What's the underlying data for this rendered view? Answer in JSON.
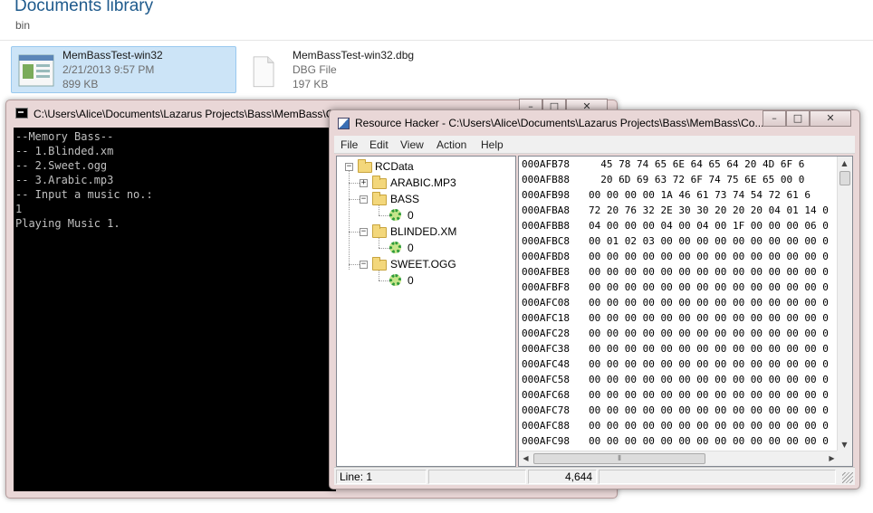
{
  "explorer": {
    "library_title": "Documents library",
    "library_subtitle": "bin",
    "files": [
      {
        "name": "MemBassTest-win32",
        "date": "2/21/2013 9:57 PM",
        "size": "899 KB",
        "icon": "application-icon",
        "selected": true
      },
      {
        "name": "MemBassTest-win32.dbg",
        "type": "DBG File",
        "size": "197 KB",
        "icon": "document-icon",
        "selected": false
      }
    ]
  },
  "console": {
    "title": "C:\\Users\\Alice\\Documents\\Lazarus Projects\\Bass\\MemBass\\Co",
    "caption_buttons": {
      "minimize": "–",
      "maximize": "□",
      "close": "✕"
    },
    "lines": [
      "--Memory Bass--",
      "-- 1.Blinded.xm",
      "-- 2.Sweet.ogg",
      "-- 3.Arabic.mp3",
      "-- Input a music no.:",
      "1",
      "Playing Music 1."
    ]
  },
  "resource_hacker": {
    "title": "Resource Hacker  -  C:\\Users\\Alice\\Documents\\Lazarus Projects\\Bass\\MemBass\\Co...",
    "caption_buttons": {
      "minimize": "–",
      "maximize": "□",
      "close": "✕"
    },
    "menu": [
      "File",
      "Edit",
      "View",
      "Action",
      "Help"
    ],
    "tree": {
      "root": "RCData",
      "children": [
        {
          "label": "ARABIC.MP3",
          "expanded": false,
          "items": []
        },
        {
          "label": "BASS",
          "expanded": true,
          "items": [
            "0"
          ]
        },
        {
          "label": "BLINDED.XM",
          "expanded": true,
          "items": [
            "0"
          ]
        },
        {
          "label": "SWEET.OGG",
          "expanded": true,
          "items": [
            "0"
          ]
        }
      ]
    },
    "hex_rows": [
      {
        "addr": "000AFB78",
        "bytes": "  45 78 74 65 6E 64 65 64 20 4D 6F 6"
      },
      {
        "addr": "000AFB88",
        "bytes": "  20 6D 69 63 72 6F 74 75 6E 65 00 0"
      },
      {
        "addr": "000AFB98",
        "bytes": "00 00 00 00 1A 46 61 73 74 54 72 61 6"
      },
      {
        "addr": "000AFBA8",
        "bytes": "72 20 76 32 2E 30 30 20 20 20 04 01 14 0"
      },
      {
        "addr": "000AFBB8",
        "bytes": "04 00 00 00 04 00 04 00 1F 00 00 00 06 0"
      },
      {
        "addr": "000AFBC8",
        "bytes": "00 01 02 03 00 00 00 00 00 00 00 00 00 0"
      },
      {
        "addr": "000AFBD8",
        "bytes": "00 00 00 00 00 00 00 00 00 00 00 00 00 0"
      },
      {
        "addr": "000AFBE8",
        "bytes": "00 00 00 00 00 00 00 00 00 00 00 00 00 0"
      },
      {
        "addr": "000AFBF8",
        "bytes": "00 00 00 00 00 00 00 00 00 00 00 00 00 0"
      },
      {
        "addr": "000AFC08",
        "bytes": "00 00 00 00 00 00 00 00 00 00 00 00 00 0"
      },
      {
        "addr": "000AFC18",
        "bytes": "00 00 00 00 00 00 00 00 00 00 00 00 00 0"
      },
      {
        "addr": "000AFC28",
        "bytes": "00 00 00 00 00 00 00 00 00 00 00 00 00 0"
      },
      {
        "addr": "000AFC38",
        "bytes": "00 00 00 00 00 00 00 00 00 00 00 00 00 0"
      },
      {
        "addr": "000AFC48",
        "bytes": "00 00 00 00 00 00 00 00 00 00 00 00 00 0"
      },
      {
        "addr": "000AFC58",
        "bytes": "00 00 00 00 00 00 00 00 00 00 00 00 00 0"
      },
      {
        "addr": "000AFC68",
        "bytes": "00 00 00 00 00 00 00 00 00 00 00 00 00 0"
      },
      {
        "addr": "000AFC78",
        "bytes": "00 00 00 00 00 00 00 00 00 00 00 00 00 0"
      },
      {
        "addr": "000AFC88",
        "bytes": "00 00 00 00 00 00 00 00 00 00 00 00 00 0"
      },
      {
        "addr": "000AFC98",
        "bytes": "00 00 00 00 00 00 00 00 00 00 00 00 00 0"
      }
    ],
    "scroll": {
      "up": "▲",
      "down": "▼",
      "left": "◀",
      "right": "▶",
      "grip": "⦀"
    },
    "status": {
      "line": "Line: 1",
      "middle": "",
      "count": "4,644",
      "last": ""
    }
  }
}
